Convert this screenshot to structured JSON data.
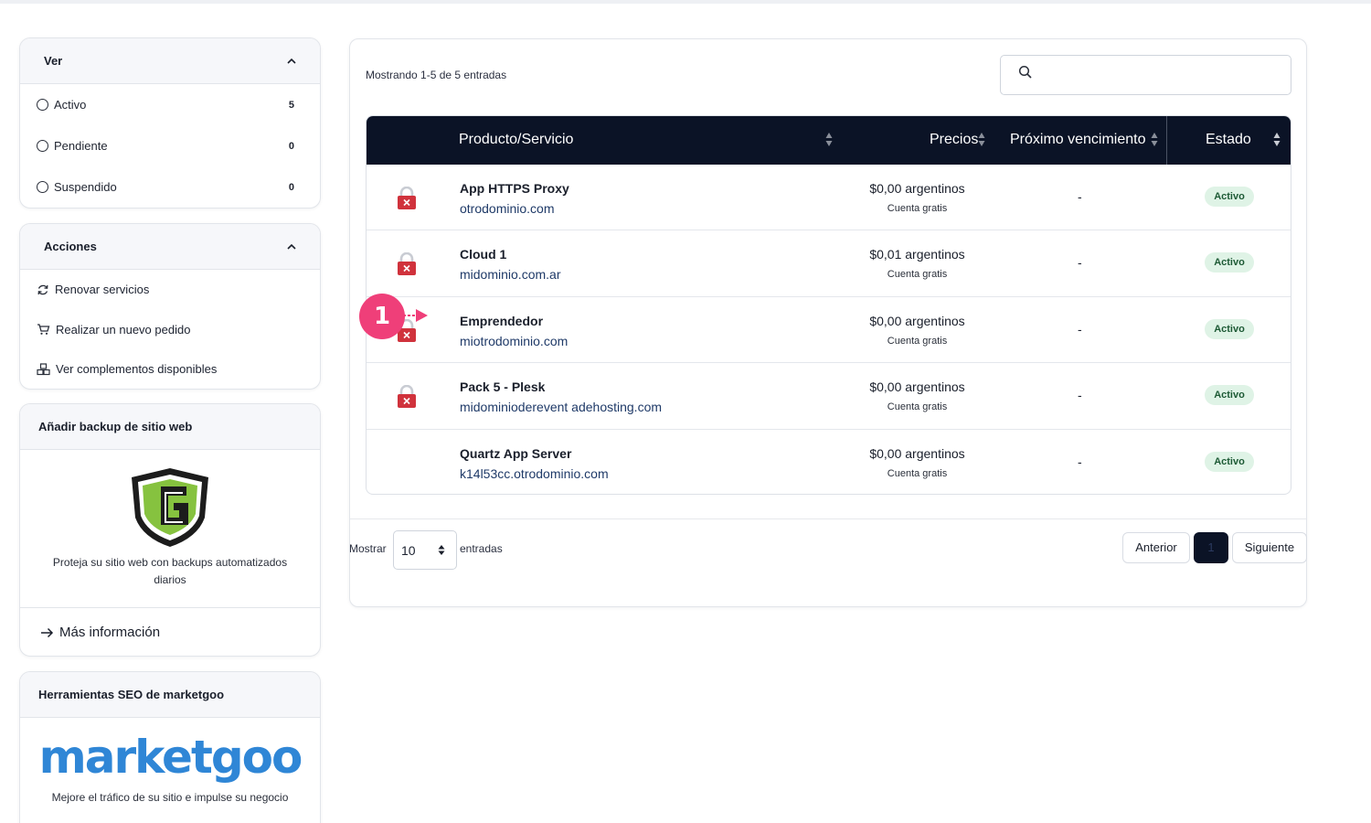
{
  "view_panel": {
    "title": "Ver",
    "items": [
      {
        "label": "Activo",
        "count": "5"
      },
      {
        "label": "Pendiente",
        "count": "0"
      },
      {
        "label": "Suspendido",
        "count": "0"
      }
    ]
  },
  "actions_panel": {
    "title": "Acciones",
    "items": [
      {
        "label": "Renovar servicios",
        "icon": "refresh-icon"
      },
      {
        "label": "Realizar un nuevo pedido",
        "icon": "cart-icon"
      },
      {
        "label": "Ver complementos disponibles",
        "icon": "cubes-icon"
      }
    ]
  },
  "backup_panel": {
    "title": "Añadir backup de sitio web",
    "description": "Proteja su sitio web con backups automatizados diarios",
    "more_label": "Más información"
  },
  "seo_panel": {
    "title": "Herramientas SEO de marketgoo",
    "logo_text": "marketgoo",
    "description": "Mejore el tráfico de su sitio e impulse su negocio"
  },
  "table": {
    "showing": "Mostrando 1-5 de 5 entradas",
    "search_placeholder": "",
    "headers": {
      "product": "Producto/Servicio",
      "price": "Precios",
      "next_due": "Próximo vencimiento",
      "status": "Estado"
    },
    "rows": [
      {
        "name": "App HTTPS Proxy",
        "domain": "otrodominio.com",
        "price": "$0,00 argentinos",
        "billing": "Cuenta gratis",
        "next_due": "-",
        "status": "Activo",
        "icon": "lock-icon"
      },
      {
        "name": "Cloud 1",
        "domain": "midominio.com.ar",
        "price": "$0,01 argentinos",
        "billing": "Cuenta gratis",
        "next_due": "-",
        "status": "Activo",
        "icon": "lock-icon"
      },
      {
        "name": "Emprendedor",
        "domain": "miotrodominio.com",
        "price": "$0,00 argentinos",
        "billing": "Cuenta gratis",
        "next_due": "-",
        "status": "Activo",
        "icon": "lock-icon"
      },
      {
        "name": "Pack 5 - Plesk",
        "domain": "midominioderevent adehosting.com",
        "price": "$0,00 argentinos",
        "billing": "Cuenta gratis",
        "next_due": "-",
        "status": "Activo",
        "icon": "lock-icon"
      },
      {
        "name": "Quartz App Server",
        "domain": "k14l53cc.otrodominio.com",
        "price": "$0,00 argentinos",
        "billing": "Cuenta gratis",
        "next_due": "-",
        "status": "Activo",
        "icon": ""
      }
    ]
  },
  "pagination": {
    "show_label": "Mostrar",
    "page_size": "10",
    "entries_label": "entradas",
    "prev": "Anterior",
    "current": "1",
    "next": "Siguiente"
  },
  "callout": {
    "number": "1"
  },
  "colors": {
    "header_bg": "#0b1326",
    "badge_bg": "#dff3e6",
    "badge_text": "#1d5a35",
    "callout": "#ef3f79",
    "link": "#1f3a68",
    "lock_red": "#d0323c"
  }
}
